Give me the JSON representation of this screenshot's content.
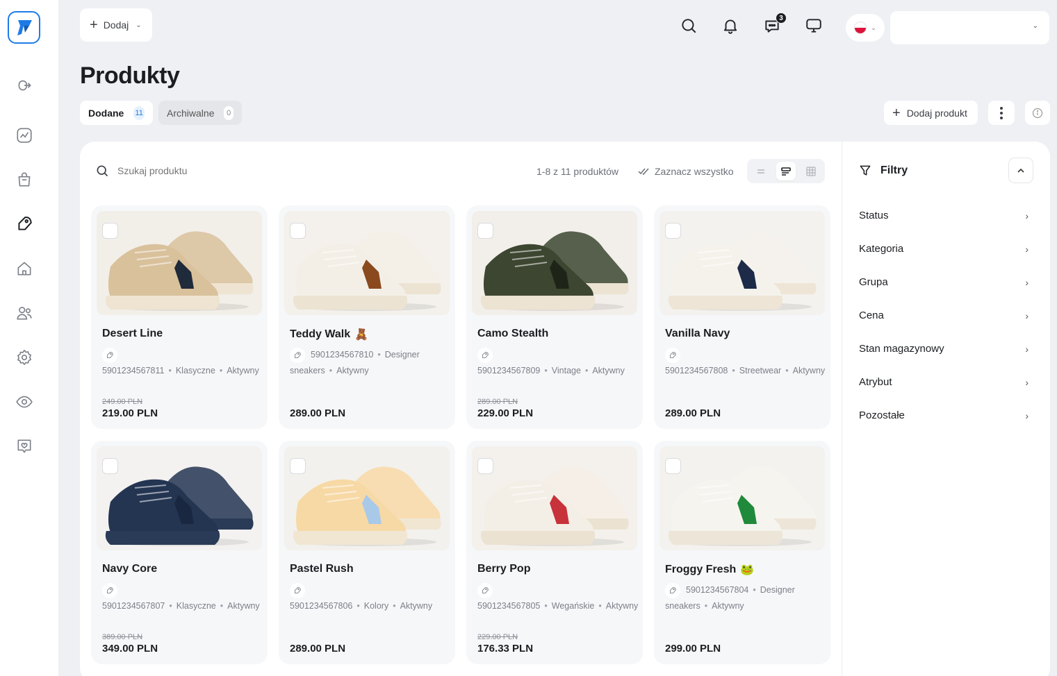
{
  "topbar": {
    "add_label": "Dodaj",
    "notifications_badge": "3"
  },
  "page": {
    "title": "Produkty"
  },
  "tabs": [
    {
      "label": "Dodane",
      "count": "11"
    },
    {
      "label": "Archiwalne",
      "count": "0"
    }
  ],
  "actions": {
    "add_product_label": "Dodaj produkt"
  },
  "toolbar": {
    "search_placeholder": "Szukaj produktu",
    "result_count": "1-8 z 11 produktów",
    "select_all_label": "Zaznacz wszystko"
  },
  "products": [
    {
      "name": "Desert Line",
      "emoji": "",
      "ean": "5901234567811",
      "meta": [
        "Klasyczne",
        "Aktywny"
      ],
      "old_price": "249.00 PLN",
      "price": "219.00 PLN",
      "colors": {
        "body": "#d9c19c",
        "accent": "#1f2a3a",
        "sole": "#efe4d1",
        "bg": "#f2efe9"
      }
    },
    {
      "name": "Teddy Walk",
      "emoji": "🧸",
      "ean": "5901234567810",
      "meta": [
        "Designer sneakers",
        "Aktywny"
      ],
      "old_price": "",
      "price": "289.00 PLN",
      "colors": {
        "body": "#f3efe6",
        "accent": "#8a4a1e",
        "sole": "#ece3d3",
        "bg": "#f4f1ec"
      }
    },
    {
      "name": "Camo Stealth",
      "emoji": "",
      "ean": "5901234567809",
      "meta": [
        "Vintage",
        "Aktywny"
      ],
      "old_price": "289.00 PLN",
      "price": "229.00 PLN",
      "colors": {
        "body": "#3c4630",
        "accent": "#1e2418",
        "sole": "#ece3d3",
        "bg": "#f2efea"
      }
    },
    {
      "name": "Vanilla Navy",
      "emoji": "",
      "ean": "5901234567808",
      "meta": [
        "Streetwear",
        "Aktywny"
      ],
      "old_price": "",
      "price": "289.00 PLN",
      "colors": {
        "body": "#f5f2ec",
        "accent": "#1d2a48",
        "sole": "#eee5d6",
        "bg": "#f4f2ee"
      }
    },
    {
      "name": "Navy Core",
      "emoji": "",
      "ean": "5901234567807",
      "meta": [
        "Klasyczne",
        "Aktywny"
      ],
      "old_price": "389.00 PLN",
      "price": "349.00 PLN",
      "colors": {
        "body": "#243552",
        "accent": "#1a2740",
        "sole": "#2a3b58",
        "bg": "#f3f2f0"
      }
    },
    {
      "name": "Pastel Rush",
      "emoji": "",
      "ean": "5901234567806",
      "meta": [
        "Kolory",
        "Aktywny"
      ],
      "old_price": "",
      "price": "289.00 PLN",
      "colors": {
        "body": "#f7d9a6",
        "accent": "#a9c9e8",
        "sole": "#f0e6d2",
        "bg": "#f3f1ed"
      }
    },
    {
      "name": "Berry Pop",
      "emoji": "",
      "ean": "5901234567805",
      "meta": [
        "Wegańskie",
        "Aktywny"
      ],
      "old_price": "229.00 PLN",
      "price": "176.33 PLN",
      "colors": {
        "body": "#f4efe6",
        "accent": "#c8323a",
        "sole": "#ebe2d2",
        "bg": "#f4f1ec"
      }
    },
    {
      "name": "Froggy Fresh",
      "emoji": "🐸",
      "ean": "5901234567804",
      "meta": [
        "Designer sneakers",
        "Aktywny"
      ],
      "old_price": "",
      "price": "299.00 PLN",
      "colors": {
        "body": "#f6f4ef",
        "accent": "#1f8a3b",
        "sole": "#ede6d8",
        "bg": "#f3f2ee"
      }
    }
  ],
  "filters": {
    "title": "Filtry",
    "items": [
      "Status",
      "Kategoria",
      "Grupa",
      "Cena",
      "Stan magazynowy",
      "Atrybut",
      "Pozostałe"
    ]
  },
  "accent_color": "#1e7be6"
}
